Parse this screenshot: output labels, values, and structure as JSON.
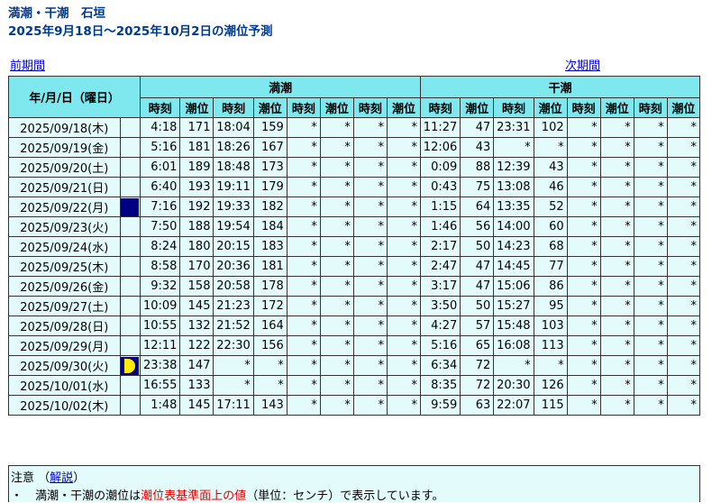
{
  "header": {
    "title_line1": "満潮・干潮　石垣",
    "title_line2": "2025年9月18日～2025年10月2日の潮位予測"
  },
  "nav": {
    "prev": "前期間",
    "next": "次期間"
  },
  "table": {
    "date_header": "年/月/日（曜日）",
    "high_tide_header": "満潮",
    "low_tide_header": "干潮",
    "sub_headers": [
      "時刻",
      "潮位",
      "時刻",
      "潮位",
      "時刻",
      "潮位",
      "時刻",
      "潮位"
    ],
    "rows": [
      {
        "date": "2025/09/18(木)",
        "moon": "",
        "high": [
          "4:18",
          "171",
          "18:04",
          "159",
          "*",
          "*",
          "*",
          "*"
        ],
        "low": [
          "11:27",
          "47",
          "23:31",
          "102",
          "*",
          "*",
          "*",
          "*"
        ]
      },
      {
        "date": "2025/09/19(金)",
        "moon": "",
        "high": [
          "5:16",
          "181",
          "18:26",
          "167",
          "*",
          "*",
          "*",
          "*"
        ],
        "low": [
          "12:06",
          "43",
          "*",
          "*",
          "*",
          "*",
          "*",
          "*"
        ]
      },
      {
        "date": "2025/09/20(土)",
        "moon": "",
        "high": [
          "6:01",
          "189",
          "18:48",
          "173",
          "*",
          "*",
          "*",
          "*"
        ],
        "low": [
          "0:09",
          "88",
          "12:39",
          "43",
          "*",
          "*",
          "*",
          "*"
        ]
      },
      {
        "date": "2025/09/21(日)",
        "moon": "",
        "high": [
          "6:40",
          "193",
          "19:11",
          "179",
          "*",
          "*",
          "*",
          "*"
        ],
        "low": [
          "0:43",
          "75",
          "13:08",
          "46",
          "*",
          "*",
          "*",
          "*"
        ]
      },
      {
        "date": "2025/09/22(月)",
        "moon": "new",
        "high": [
          "7:16",
          "192",
          "19:33",
          "182",
          "*",
          "*",
          "*",
          "*"
        ],
        "low": [
          "1:15",
          "64",
          "13:35",
          "52",
          "*",
          "*",
          "*",
          "*"
        ]
      },
      {
        "date": "2025/09/23(火)",
        "moon": "",
        "high": [
          "7:50",
          "188",
          "19:54",
          "184",
          "*",
          "*",
          "*",
          "*"
        ],
        "low": [
          "1:46",
          "56",
          "14:00",
          "60",
          "*",
          "*",
          "*",
          "*"
        ]
      },
      {
        "date": "2025/09/24(水)",
        "moon": "",
        "high": [
          "8:24",
          "180",
          "20:15",
          "183",
          "*",
          "*",
          "*",
          "*"
        ],
        "low": [
          "2:17",
          "50",
          "14:23",
          "68",
          "*",
          "*",
          "*",
          "*"
        ]
      },
      {
        "date": "2025/09/25(木)",
        "moon": "",
        "high": [
          "8:58",
          "170",
          "20:36",
          "181",
          "*",
          "*",
          "*",
          "*"
        ],
        "low": [
          "2:47",
          "47",
          "14:45",
          "77",
          "*",
          "*",
          "*",
          "*"
        ]
      },
      {
        "date": "2025/09/26(金)",
        "moon": "",
        "high": [
          "9:32",
          "158",
          "20:58",
          "178",
          "*",
          "*",
          "*",
          "*"
        ],
        "low": [
          "3:17",
          "47",
          "15:06",
          "86",
          "*",
          "*",
          "*",
          "*"
        ]
      },
      {
        "date": "2025/09/27(土)",
        "moon": "",
        "high": [
          "10:09",
          "145",
          "21:23",
          "172",
          "*",
          "*",
          "*",
          "*"
        ],
        "low": [
          "3:50",
          "50",
          "15:27",
          "95",
          "*",
          "*",
          "*",
          "*"
        ]
      },
      {
        "date": "2025/09/28(日)",
        "moon": "",
        "high": [
          "10:55",
          "132",
          "21:52",
          "164",
          "*",
          "*",
          "*",
          "*"
        ],
        "low": [
          "4:27",
          "57",
          "15:48",
          "103",
          "*",
          "*",
          "*",
          "*"
        ]
      },
      {
        "date": "2025/09/29(月)",
        "moon": "",
        "high": [
          "12:11",
          "122",
          "22:30",
          "156",
          "*",
          "*",
          "*",
          "*"
        ],
        "low": [
          "5:16",
          "65",
          "16:08",
          "113",
          "*",
          "*",
          "*",
          "*"
        ]
      },
      {
        "date": "2025/09/30(火)",
        "moon": "first-quarter",
        "high": [
          "23:38",
          "147",
          "*",
          "*",
          "*",
          "*",
          "*",
          "*"
        ],
        "low": [
          "6:34",
          "72",
          "*",
          "*",
          "*",
          "*",
          "*",
          "*"
        ]
      },
      {
        "date": "2025/10/01(水)",
        "moon": "",
        "high": [
          "16:55",
          "133",
          "*",
          "*",
          "*",
          "*",
          "*",
          "*"
        ],
        "low": [
          "8:35",
          "72",
          "20:30",
          "126",
          "*",
          "*",
          "*",
          "*"
        ]
      },
      {
        "date": "2025/10/02(木)",
        "moon": "",
        "high": [
          "1:48",
          "145",
          "17:11",
          "143",
          "*",
          "*",
          "*",
          "*"
        ],
        "low": [
          "9:59",
          "63",
          "22:07",
          "115",
          "*",
          "*",
          "*",
          "*"
        ]
      }
    ]
  },
  "notes": {
    "caution": "注意",
    "open_paren": "（",
    "explanation_link": "解説",
    "close_paren": "）",
    "bullet": "・",
    "text_before": "満潮・干潮の潮位は",
    "highlight": "潮位表基準面上の値",
    "text_after": "（単位：センチ）で表示しています。"
  },
  "colors": {
    "header_bg": "#7fe8ee",
    "cell_bg": "#e4fbfc",
    "title": "#003a8c",
    "link": "#0000cc",
    "highlight": "#e00000",
    "new_moon": "#000080",
    "moon_yellow": "#ffeb00"
  }
}
